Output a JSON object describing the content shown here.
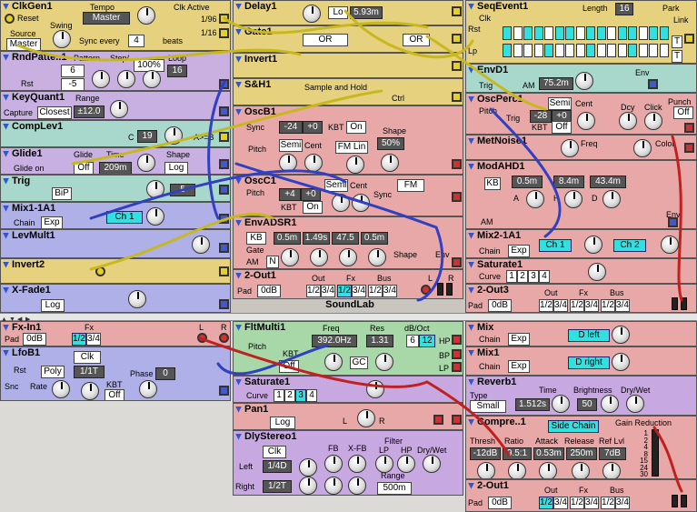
{
  "app": {
    "title": "SoundLab"
  },
  "rack1": {
    "clkgen": {
      "name": "ClkGen1",
      "reset": "Reset",
      "tempo_label": "Tempo",
      "tempo": "Master",
      "swing": "Swing",
      "source_label": "Source",
      "source": "Master",
      "clk_active": "Clk Active",
      "div1": "1/96",
      "div2": "1/16",
      "sync_label": "Sync every",
      "sync_val": "4",
      "beats": "beats"
    },
    "rndpat": {
      "name": "RndPatte..1",
      "pattern_label": "Pattern",
      "step_label": "Step/",
      "prob_label": "Prob",
      "loop_label": "Loop",
      "a": "6",
      "b": "-5",
      "prob": "100%",
      "loop": "16",
      "rst": "Rst"
    },
    "keyq": {
      "name": "KeyQuant1",
      "range_label": "Range",
      "capture_label": "Capture",
      "capture": "Closest",
      "range": "±12.0"
    },
    "complev": {
      "name": "CompLev1",
      "c_label": "C",
      "c": "19",
      "cmp": "A>=B"
    },
    "glide": {
      "name": "Glide1",
      "glide_label": "Glide",
      "glide_on": "Glide on",
      "off": "Off",
      "time_label": "Time",
      "time": "209m",
      "shape_label": "Shape",
      "shape": "Log"
    },
    "trig": {
      "name": "Trig",
      "mode": "BiP",
      "val": "5"
    },
    "mix1a1": {
      "name": "Mix1-1A1",
      "chain": "Chain",
      "exp": "Exp",
      "ch": "Ch 1"
    },
    "levmult": {
      "name": "LevMult1"
    },
    "invert2": {
      "name": "Invert2"
    },
    "xfade": {
      "name": "X-Fade1",
      "log": "Log"
    },
    "delay1": {
      "name": "Delay1",
      "lo": "Lo",
      "time": "5.93m"
    },
    "gate1": {
      "name": "Gate1",
      "op1": "OR",
      "op2": "OR"
    },
    "invert1": {
      "name": "Invert1"
    },
    "sh1": {
      "name": "S&H1",
      "desc": "Sample and Hold",
      "ctrl": "Ctrl"
    },
    "oscb1": {
      "name": "OscB1",
      "sync": "Sync",
      "coarse": "-24",
      "fine": "+0",
      "kbt_label": "KBT",
      "kbt": "On",
      "shape_label": "Shape",
      "shape": "50%",
      "pitch": "Pitch",
      "semi": "Semi",
      "cent": "Cent",
      "fm": "FM Lin"
    },
    "oscc1": {
      "name": "OscC1",
      "pitch": "Pitch",
      "coarse": "+4",
      "fine": "+0",
      "kbt_label": "KBT",
      "kbt": "On",
      "semi": "Semi",
      "cent": "Cent",
      "sync": "Sync",
      "fm": "FM"
    },
    "envadsr": {
      "name": "EnvADSR1",
      "kb": "KB",
      "gate": "Gate",
      "am": "AM",
      "n": "N",
      "a": "0.5m",
      "d": "1.49s",
      "s": "47.5",
      "r": "0.5m",
      "shape": "Shape",
      "env": "Env"
    },
    "out2": {
      "name": "2-Out1",
      "pad": "Pad",
      "db": "0dB",
      "out_label": "Out",
      "fx_label": "Fx",
      "bus_label": "Bus",
      "out": "1/2",
      "o2": "3/4",
      "fx": "1/2",
      "f2": "3/4",
      "bus": "1/2",
      "b2": "3/4",
      "l": "L",
      "r": "R"
    },
    "seqevent": {
      "name": "SeqEvent1",
      "length_label": "Length",
      "length": "16",
      "park": "Park",
      "clk": "Clk",
      "link": "Link",
      "rst": "Rst",
      "lp": "Lp",
      "t": "T"
    },
    "envd": {
      "name": "EnvD1",
      "trig": "Trig",
      "am": "AM",
      "time": "75.2m",
      "env": "Env"
    },
    "oscperc": {
      "name": "OscPerc1",
      "pitch": "Pitch",
      "trig": "Trig",
      "semi": "Semi",
      "cent": "Cent",
      "coarse": "-28",
      "fine": "+0",
      "kbt_label": "KBT",
      "kbt": "Off",
      "decay_label": "Dcy",
      "click_label": "Click",
      "punch_label": "Punch",
      "punch": "Off"
    },
    "metnoise": {
      "name": "MetNoise1",
      "freq": "Freq",
      "color": "Color"
    },
    "modahd": {
      "name": "ModAHD1",
      "kb": "KB",
      "a": "0.5m",
      "h": "8.4m",
      "d": "43.4m",
      "a_l": "A",
      "h_l": "H",
      "d_l": "D",
      "am": "AM",
      "env": "Env"
    },
    "mix21a": {
      "name": "Mix2-1A1",
      "chain": "Chain",
      "exp": "Exp",
      "ch1": "Ch 1",
      "ch2": "Ch 2"
    },
    "saturate1": {
      "name": "Saturate1",
      "curve": "Curve",
      "c1": "1",
      "c2": "2",
      "c3": "3",
      "c4": "4"
    },
    "out3": {
      "name": "2-Out3",
      "pad": "Pad",
      "db": "0dB",
      "out_label": "Out",
      "fx_label": "Fx",
      "bus_label": "Bus",
      "out": "1/2",
      "o2": "3/4",
      "fx": "1/2",
      "f2": "3/4",
      "bus": "1/2",
      "b2": "3/4"
    }
  },
  "rack2": {
    "fxin": {
      "name": "Fx-In1",
      "pad": "Pad",
      "db": "0dB",
      "fx_label": "Fx",
      "fx": "1/2",
      "f2": "3/4",
      "l": "L",
      "r": "R"
    },
    "lfob": {
      "name": "LfoB1",
      "rst": "Rst",
      "clk": "Clk",
      "poly": "Poly",
      "rate_val": "1/1T",
      "snc": "Snc",
      "rate": "Rate",
      "kbt_label": "KBT",
      "kbt": "Off",
      "phase_label": "Phase",
      "phase": "0"
    },
    "fltmulti": {
      "name": "FltMulti1",
      "freq_label": "Freq",
      "freq": "392.0Hz",
      "res_label": "Res",
      "res": "1.31",
      "db_label": "dB/Oct",
      "d1": "6",
      "d2": "12",
      "pitch": "Pitch",
      "kbt_label": "KBT",
      "kbt": "Off",
      "gc": "GC",
      "hp": "HP",
      "bp": "BP",
      "lp": "LP"
    },
    "saturate2": {
      "name": "Saturate1",
      "curve": "Curve",
      "c1": "1",
      "c2": "2",
      "c3": "3",
      "c4": "4"
    },
    "pan1": {
      "name": "Pan1",
      "log": "Log",
      "l": "L",
      "r": "R"
    },
    "dlystereo": {
      "name": "DlyStereo1",
      "clk": "Clk",
      "fb": "FB",
      "xfb": "X-FB",
      "filter_label": "Filter",
      "lp": "LP",
      "hp": "HP",
      "drywet": "Dry/Wet",
      "left_label": "Left",
      "left": "1/4D",
      "right_label": "Right",
      "right": "1/2T",
      "range_label": "Range",
      "range": "500m"
    },
    "mix": {
      "name": "Mix",
      "chain": "Chain",
      "exp": "Exp",
      "dest": "D left"
    },
    "mix1": {
      "name": "Mix1",
      "chain": "Chain",
      "exp": "Exp",
      "dest": "D right"
    },
    "reverb1": {
      "name": "Reverb1",
      "type_label": "Type",
      "type": "Small",
      "time_label": "Time",
      "time": "1.512s",
      "bright_label": "Brightness",
      "bright": "50",
      "drywet": "Dry/Wet"
    },
    "compre": {
      "name": "Compre..1",
      "side": "Side Chain",
      "gain_red": "Gain Reduction",
      "thresh_label": "Thresh",
      "ratio_label": "Ratio",
      "attack_label": "Attack",
      "release_label": "Release",
      "reflvl_label": "Ref Lvl",
      "thresh": "-12dB",
      "ratio": "9.5:1",
      "attack": "0.53m",
      "release": "250m",
      "reflvl": "7dB",
      "gr": [
        "1",
        "2",
        "4",
        "8",
        "15",
        "24",
        "30"
      ]
    },
    "out1": {
      "name": "2-Out1",
      "pad": "Pad",
      "db": "0dB",
      "out_label": "Out",
      "fx_label": "Fx",
      "bus_label": "Bus",
      "out": "1/2",
      "o2": "3/4",
      "fx": "1/2",
      "f2": "3/4",
      "bus": "1/2",
      "b2": "3/4"
    }
  },
  "colors": {
    "yellow": "#e6cf7a",
    "pink": "#e8a8a8",
    "purple": "#c8a8e0",
    "lavender": "#b0b0e8",
    "teal": "#a8d8c8",
    "green": "#a8d8a8"
  }
}
